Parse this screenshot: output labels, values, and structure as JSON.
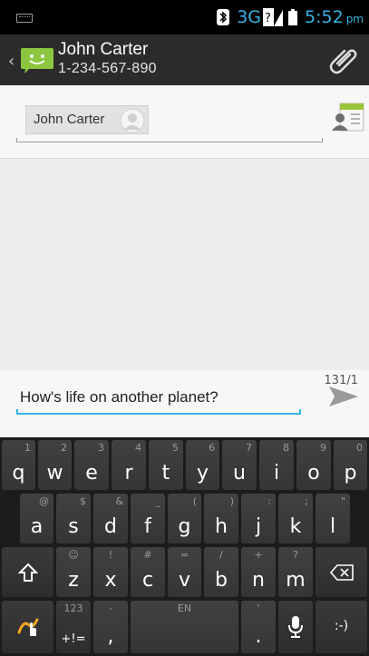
{
  "status_bar": {
    "network": "3G",
    "time": "5:52",
    "ampm": "pm",
    "accent_color": "#33b5e5"
  },
  "action_bar": {
    "contact_name": "John Carter",
    "contact_number": "1-234-567-890",
    "icons": [
      "back-icon",
      "messaging-app-icon",
      "attach-icon"
    ]
  },
  "recipient": {
    "chip_name": "John Carter"
  },
  "compose": {
    "char_counter": "131/1",
    "message_text": "How's life on another planet?"
  },
  "keyboard": {
    "row1": [
      {
        "key": "q",
        "hint": "1"
      },
      {
        "key": "w",
        "hint": "2"
      },
      {
        "key": "e",
        "hint": "3"
      },
      {
        "key": "r",
        "hint": "4"
      },
      {
        "key": "t",
        "hint": "5"
      },
      {
        "key": "y",
        "hint": "6"
      },
      {
        "key": "u",
        "hint": "7"
      },
      {
        "key": "i",
        "hint": "8"
      },
      {
        "key": "o",
        "hint": "9"
      },
      {
        "key": "p",
        "hint": "0"
      }
    ],
    "row2": [
      {
        "key": "a",
        "hint": "@"
      },
      {
        "key": "s",
        "hint": "$"
      },
      {
        "key": "d",
        "hint": "&"
      },
      {
        "key": "f",
        "hint": "_"
      },
      {
        "key": "g",
        "hint": "("
      },
      {
        "key": "h",
        "hint": ")"
      },
      {
        "key": "j",
        "hint": ":"
      },
      {
        "key": "k",
        "hint": ";"
      },
      {
        "key": "l",
        "hint": "\""
      }
    ],
    "row3": [
      {
        "key": "z",
        "hint": "☺"
      },
      {
        "key": "x",
        "hint": "!"
      },
      {
        "key": "c",
        "hint": "#"
      },
      {
        "key": "v",
        "hint": "="
      },
      {
        "key": "b",
        "hint": "/"
      },
      {
        "key": "n",
        "hint": "+"
      },
      {
        "key": "m",
        "hint": "?"
      }
    ],
    "row4": {
      "symbols_hint": "123",
      "symbols_main": "+!=",
      "comma_hint": "-",
      "comma": ",",
      "space_hint": "EN",
      "period_hint": "'",
      "period": ".",
      "smiley": ":-)"
    }
  }
}
